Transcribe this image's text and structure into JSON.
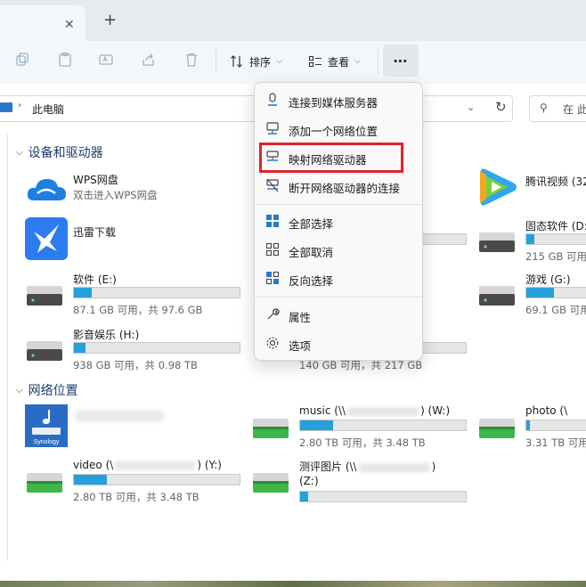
{
  "tabbar": {
    "close": "✕",
    "new_tab": "+"
  },
  "toolbar": {
    "sort_label": "排序",
    "view_label": "查看",
    "more_label": "⋯",
    "icons": [
      "copy-icon",
      "paste-icon",
      "rename-icon",
      "share-icon",
      "delete-icon"
    ]
  },
  "address": {
    "path": "此电脑",
    "search_placeholder": "在 此"
  },
  "sections": {
    "devices": "设备和驱动器",
    "network": "网络位置"
  },
  "drives": [
    {
      "name": "WPS网盘",
      "sub": "双击进入WPS网盘"
    },
    {
      "name": "迅雷下载",
      "sub": ""
    },
    {
      "name": "软件 (E:)",
      "free": "87.1 GB 可用，共 97.6 GB",
      "usage": 0.11
    },
    {
      "name": "影音娱乐 (H:)",
      "free": "938 GB 可用，共 0.98 TB",
      "usage": 0.07
    },
    {
      "name": "",
      "free": "140 GB 可用，共 217 GB",
      "usage": 0.35
    },
    {
      "name": "腾讯视频 (32",
      "sub": ""
    },
    {
      "name": "固态软件 (D:",
      "free": "215 GB 可用",
      "usage": 0.12
    },
    {
      "name": "游戏 (G:)",
      "free": "69.1 GB 可用",
      "usage": 0.4
    }
  ],
  "network": [
    {
      "name": "",
      "kind": "synology"
    },
    {
      "name": "music (\\\\",
      "suffix": ") (W:)",
      "free": "2.80 TB 可用，共 3.48 TB",
      "usage": 0.2
    },
    {
      "name": "photo (\\",
      "free": "3.31 TB 可用",
      "usage": 0.05
    },
    {
      "name": "video (\\",
      "suffix": ") (Y:)",
      "free": "2.80 TB 可用，共 3.48 TB",
      "usage": 0.2
    },
    {
      "name": "测评图片 (\\\\",
      "suffix": ")",
      "drive": "(Z:)",
      "usage": 0.05
    }
  ],
  "menu": [
    {
      "label": "连接到媒体服务器",
      "icon": "media-server-icon"
    },
    {
      "label": "添加一个网络位置",
      "icon": "network-location-icon"
    },
    {
      "label": "映射网络驱动器",
      "icon": "map-drive-icon"
    },
    {
      "label": "断开网络驱动器的连接",
      "icon": "disconnect-drive-icon"
    },
    {
      "label": "全部选择",
      "icon": "select-all-icon"
    },
    {
      "label": "全部取消",
      "icon": "select-none-icon"
    },
    {
      "label": "反向选择",
      "icon": "invert-selection-icon"
    },
    {
      "label": "属性",
      "icon": "properties-icon"
    },
    {
      "label": "选项",
      "icon": "options-icon"
    }
  ],
  "colors": {
    "accent": "#26a0da",
    "highlight_box": "#e0222c",
    "section_title": "#1f3a6e"
  }
}
